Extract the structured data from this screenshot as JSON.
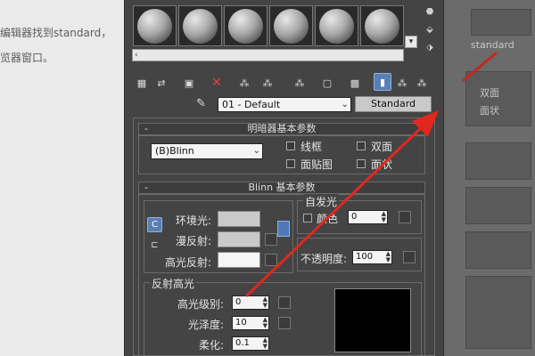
{
  "background_left": {
    "line1": "编辑器找到standard，",
    "line2": "览器窗口。"
  },
  "background_right": {
    "item1": "standard",
    "item2": "双面",
    "item3": "面状"
  },
  "toolbar": {
    "material_name": "01 - Default",
    "material_type_button": "Standard"
  },
  "shader_basic_params": {
    "title": "明暗器基本参数",
    "shader_type": "(B)Blinn",
    "wire_label": "线框",
    "two_sided_label": "双面",
    "face_map_label": "面贴图",
    "faceted_label": "面状"
  },
  "blinn_basic_params": {
    "title": "Blinn 基本参数",
    "ambient_label": "环境光:",
    "diffuse_label": "漫反射:",
    "specular_label": "高光反射:",
    "self_illum_title": "自发光",
    "color_label": "颜色",
    "self_illum_value": "0",
    "opacity_label": "不透明度:",
    "opacity_value": "100"
  },
  "specular_highlights": {
    "title": "反射高光",
    "spec_level_label": "高光级别:",
    "spec_level_value": "0",
    "glossiness_label": "光泽度:",
    "glossiness_value": "10",
    "soften_label": "柔化:",
    "soften_value": "0.1"
  },
  "colors": {
    "accent_blue": "#5a7fb4",
    "arrow_red": "#e0281e"
  },
  "icons": [
    "sphere-slot",
    "get-material-icon",
    "put-to-scene-icon",
    "assign-icon",
    "delete-icon",
    "copy-icon",
    "unique-icon",
    "pick-icon",
    "show-map-icon",
    "background-icon",
    "show-end-icon",
    "go-parent-icon",
    "go-sibling-icon",
    "eyedropper-icon"
  ]
}
